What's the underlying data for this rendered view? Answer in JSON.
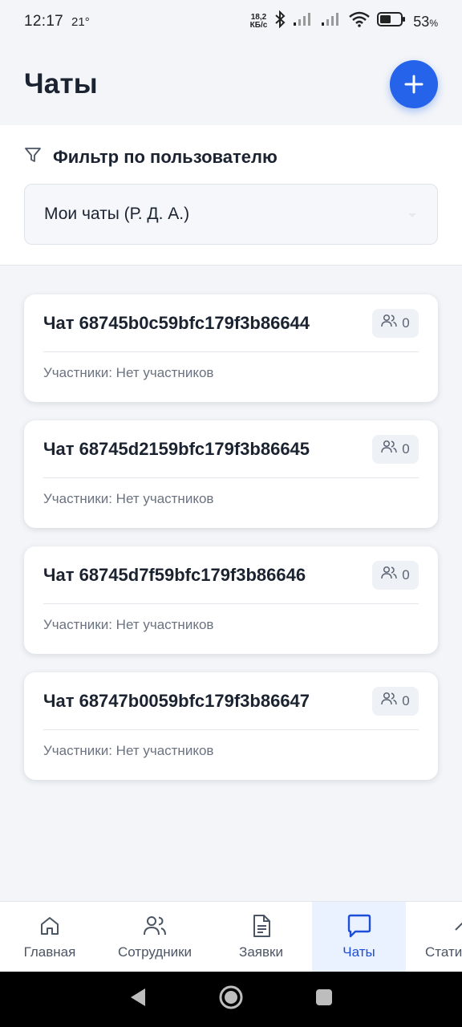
{
  "status_bar": {
    "time": "12:17",
    "temperature": "21°",
    "net_speed_value": "18,2",
    "net_speed_unit": "КБ/с",
    "battery_percent": "53",
    "battery_percent_sign": "%",
    "battery_level": 0.53
  },
  "header": {
    "title": "Чаты",
    "add_button_icon": "plus-icon"
  },
  "filter": {
    "title": "Фильтр по пользователю",
    "icon": "filter-icon",
    "selected_value": "Мои чаты (Р. Д. А.)"
  },
  "chats": [
    {
      "name": "Чат 68745b0c59bfc179f3b86644",
      "member_count": "0",
      "members": "Участники: Нет участников"
    },
    {
      "name": "Чат 68745d2159bfc179f3b86645",
      "member_count": "0",
      "members": "Участники: Нет участников"
    },
    {
      "name": "Чат 68745d7f59bfc179f3b86646",
      "member_count": "0",
      "members": "Участники: Нет участников"
    },
    {
      "name": "Чат 68747b0059bfc179f3b86647",
      "member_count": "0",
      "members": "Участники: Нет участников"
    }
  ],
  "bottom_nav": {
    "items": [
      {
        "label": "Главная",
        "icon": "home-icon",
        "active": false
      },
      {
        "label": "Сотрудники",
        "icon": "users-icon",
        "active": false
      },
      {
        "label": "Заявки",
        "icon": "document-icon",
        "active": false
      },
      {
        "label": "Чаты",
        "icon": "chat-icon",
        "active": true
      },
      {
        "label": "Стати",
        "icon": "chevron-up-icon",
        "active": false
      }
    ]
  },
  "colors": {
    "accent": "#2563eb",
    "background": "#f3f5f8",
    "active_nav_bg": "#eaf1ff"
  }
}
